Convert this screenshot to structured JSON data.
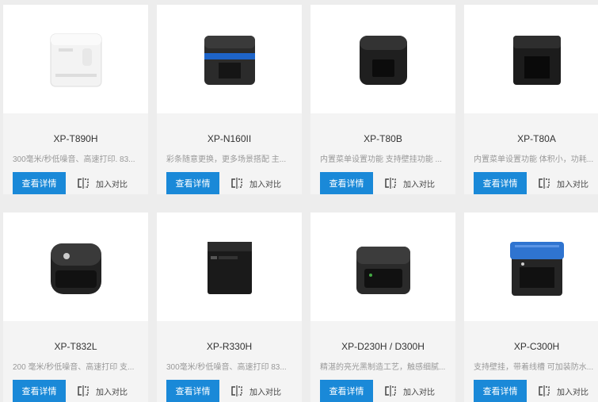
{
  "products": [
    {
      "name": "XP-T890H",
      "desc": "300毫米/秒低噪音、高速打印. 83...",
      "detail_label": "查看详情",
      "compare_label": "加入对比"
    },
    {
      "name": "XP-N160II",
      "desc": "彩条随意更换，更多场景搭配 主...",
      "detail_label": "查看详情",
      "compare_label": "加入对比"
    },
    {
      "name": "XP-T80B",
      "desc": "内置菜单设置功能 支持壁挂功能 ...",
      "detail_label": "查看详情",
      "compare_label": "加入对比"
    },
    {
      "name": "XP-T80A",
      "desc": "内置菜单设置功能 体积小，功耗...",
      "detail_label": "查看详情",
      "compare_label": "加入对比"
    },
    {
      "name": "XP-T832L",
      "desc": "200 毫米/秒低噪音、高速打印 支...",
      "detail_label": "查看详情",
      "compare_label": "加入对比"
    },
    {
      "name": "XP-R330H",
      "desc": "300毫米/秒低噪音、高速打印 83...",
      "detail_label": "查看详情",
      "compare_label": "加入对比"
    },
    {
      "name": "XP-D230H / D300H",
      "desc": "精湛的亮光黑制造工艺，触感细腻...",
      "detail_label": "查看详情",
      "compare_label": "加入对比"
    },
    {
      "name": "XP-C300H",
      "desc": "支持壁挂，带着线槽 可加装防水...",
      "detail_label": "查看详情",
      "compare_label": "加入对比"
    }
  ],
  "icons": {
    "compare": "compare-icon",
    "product": "printer-image"
  },
  "colors": {
    "accent": "#1a89d8",
    "card_bg": "#f4f4f4",
    "page_bg": "#ededed"
  }
}
